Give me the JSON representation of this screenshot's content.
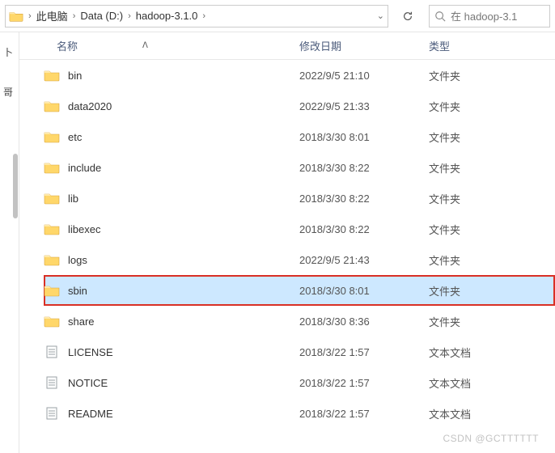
{
  "toolbar": {
    "breadcrumb": [
      "此电脑",
      "Data (D:)",
      "hadoop-3.1.0"
    ],
    "search_placeholder": "在 hadoop-3.1"
  },
  "leftedge": {
    "char1": "卜",
    "char2": "哥"
  },
  "columns": {
    "name": "名称",
    "date": "修改日期",
    "type": "类型",
    "sort_indicator": "ᐱ"
  },
  "rows": [
    {
      "icon": "folder",
      "name": "bin",
      "date": "2022/9/5 21:10",
      "type": "文件夹",
      "selected": false,
      "highlighted": false
    },
    {
      "icon": "folder",
      "name": "data2020",
      "date": "2022/9/5 21:33",
      "type": "文件夹",
      "selected": false,
      "highlighted": false
    },
    {
      "icon": "folder",
      "name": "etc",
      "date": "2018/3/30 8:01",
      "type": "文件夹",
      "selected": false,
      "highlighted": false
    },
    {
      "icon": "folder",
      "name": "include",
      "date": "2018/3/30 8:22",
      "type": "文件夹",
      "selected": false,
      "highlighted": false
    },
    {
      "icon": "folder",
      "name": "lib",
      "date": "2018/3/30 8:22",
      "type": "文件夹",
      "selected": false,
      "highlighted": false
    },
    {
      "icon": "folder",
      "name": "libexec",
      "date": "2018/3/30 8:22",
      "type": "文件夹",
      "selected": false,
      "highlighted": false
    },
    {
      "icon": "folder",
      "name": "logs",
      "date": "2022/9/5 21:43",
      "type": "文件夹",
      "selected": false,
      "highlighted": false
    },
    {
      "icon": "folder",
      "name": "sbin",
      "date": "2018/3/30 8:01",
      "type": "文件夹",
      "selected": true,
      "highlighted": true
    },
    {
      "icon": "folder",
      "name": "share",
      "date": "2018/3/30 8:36",
      "type": "文件夹",
      "selected": false,
      "highlighted": false
    },
    {
      "icon": "file",
      "name": "LICENSE",
      "date": "2018/3/22 1:57",
      "type": "文本文档",
      "selected": false,
      "highlighted": false
    },
    {
      "icon": "file",
      "name": "NOTICE",
      "date": "2018/3/22 1:57",
      "type": "文本文档",
      "selected": false,
      "highlighted": false
    },
    {
      "icon": "file",
      "name": "README",
      "date": "2018/3/22 1:57",
      "type": "文本文档",
      "selected": false,
      "highlighted": false
    }
  ],
  "watermark": "CSDN @GCTTTTTT"
}
